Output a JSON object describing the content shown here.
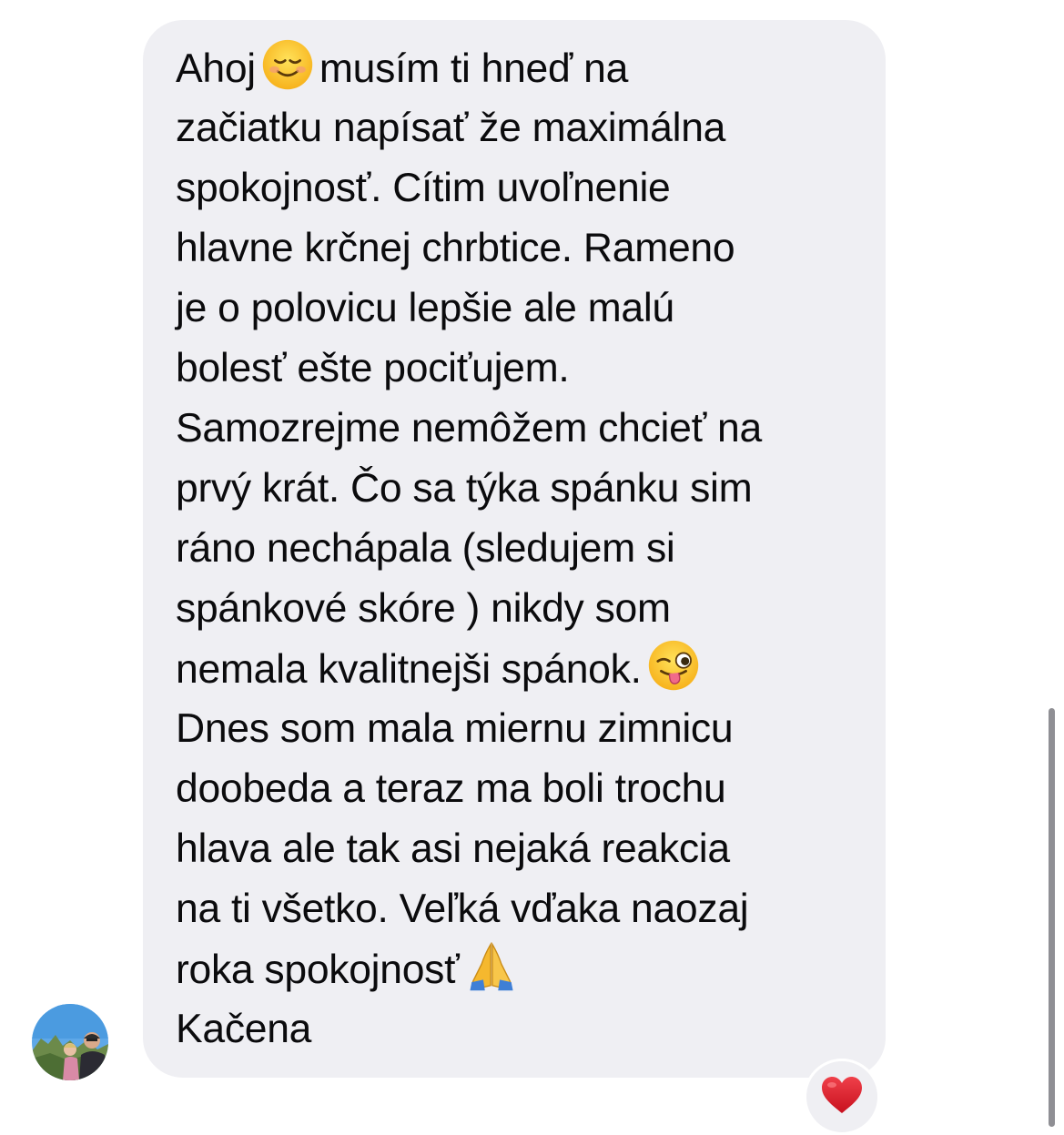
{
  "message": {
    "lines": [
      {
        "before": "Ahoj",
        "emoji": "smiling-face-icon",
        "after": "musím ti hneď na"
      },
      {
        "text": "začiatku napísať že maximálna"
      },
      {
        "text": "spokojnosť. Cítim uvoľnenie"
      },
      {
        "text": "hlavne krčnej chrbtice. Rameno"
      },
      {
        "text": "je o polovicu lepšie ale malú"
      },
      {
        "text": "bolesť ešte pociťujem."
      },
      {
        "text": "Samozrejme nemôžem chcieť na"
      },
      {
        "text": "prvý krát. Čo sa týka spánku sim"
      },
      {
        "text": "ráno nechápala (sledujem si"
      },
      {
        "text": "spánkové skóre ) nikdy som"
      },
      {
        "before": "nemala kvalitnejši spánok.",
        "emoji": "winking-tongue-face-icon",
        "after": ""
      },
      {
        "text": "Dnes som mala miernu zimnicu"
      },
      {
        "text": "doobeda a teraz ma boli trochu"
      },
      {
        "text": "hlava ale tak asi nejaká reakcia"
      },
      {
        "text": "na ti všetko. Veľká vďaka naozaj"
      },
      {
        "before": "roka spokojnosť",
        "emoji": "folded-hands-icon",
        "after": ""
      },
      {
        "text": "Kačena"
      }
    ]
  },
  "sender": {
    "avatar_icon": "profile-photo"
  },
  "reaction": {
    "icon": "red-heart-icon"
  },
  "colors": {
    "bubble": "#efeff3",
    "text": "#0b0b0d",
    "heart": "#e0202e",
    "background": "#ffffff"
  }
}
